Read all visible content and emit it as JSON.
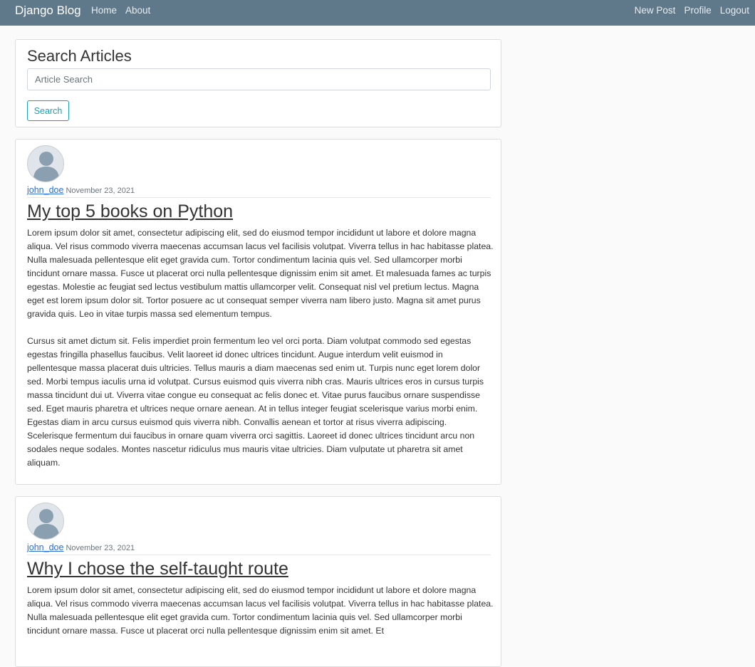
{
  "navbar": {
    "brand": "Django Blog",
    "left_links": [
      "Home",
      "About"
    ],
    "right_links": [
      "New Post",
      "Profile",
      "Logout"
    ],
    "background_color": "#5f788a"
  },
  "search": {
    "title": "Search Articles",
    "placeholder": "Article Search",
    "value": "",
    "button_label": "Search",
    "button_color": "#17a2b8"
  },
  "posts": [
    {
      "author": "john_doe",
      "date": "November 23, 2021",
      "title": "My top 5 books on Python",
      "paragraphs": [
        "Lorem ipsum dolor sit amet, consectetur adipiscing elit, sed do eiusmod tempor incididunt ut labore et dolore magna aliqua. Vel risus commodo viverra maecenas accumsan lacus vel facilisis volutpat. Viverra tellus in hac habitasse platea. Nulla malesuada pellentesque elit eget gravida cum. Tortor condimentum lacinia quis vel. Sed ullamcorper morbi tincidunt ornare massa. Fusce ut placerat orci nulla pellentesque dignissim enim sit amet. Et malesuada fames ac turpis egestas. Molestie ac feugiat sed lectus vestibulum mattis ullamcorper velit. Consequat nisl vel pretium lectus. Magna eget est lorem ipsum dolor sit. Tortor posuere ac ut consequat semper viverra nam libero justo. Magna sit amet purus gravida quis. Leo in vitae turpis massa sed elementum tempus.",
        "Cursus sit amet dictum sit. Felis imperdiet proin fermentum leo vel orci porta. Diam volutpat commodo sed egestas egestas fringilla phasellus faucibus. Velit laoreet id donec ultrices tincidunt. Augue interdum velit euismod in pellentesque massa placerat duis ultricies. Tellus mauris a diam maecenas sed enim ut. Turpis nunc eget lorem dolor sed. Morbi tempus iaculis urna id volutpat. Cursus euismod quis viverra nibh cras. Mauris ultrices eros in cursus turpis massa tincidunt dui ut. Viverra vitae congue eu consequat ac felis donec et. Vitae purus faucibus ornare suspendisse sed. Eget mauris pharetra et ultrices neque ornare aenean. At in tellus integer feugiat scelerisque varius morbi enim. Egestas diam in arcu cursus euismod quis viverra nibh. Convallis aenean et tortor at risus viverra adipiscing. Scelerisque fermentum dui faucibus in ornare quam viverra orci sagittis. Laoreet id donec ultrices tincidunt arcu non sodales neque sodales. Montes nascetur ridiculus mus mauris vitae ultricies. Diam vulputate ut pharetra sit amet aliquam."
      ]
    },
    {
      "author": "john_doe",
      "date": "November 23, 2021",
      "title": "Why I chose the self-taught route",
      "paragraphs": [
        "Lorem ipsum dolor sit amet, consectetur adipiscing elit, sed do eiusmod tempor incididunt ut labore et dolore magna aliqua. Vel risus commodo viverra maecenas accumsan lacus vel facilisis volutpat. Viverra tellus in hac habitasse platea. Nulla malesuada pellentesque elit eget gravida cum. Tortor condimentum lacinia quis vel. Sed ullamcorper morbi tincidunt ornare massa. Fusce ut placerat orci nulla pellentesque dignissim enim sit amet. Et"
      ]
    }
  ]
}
